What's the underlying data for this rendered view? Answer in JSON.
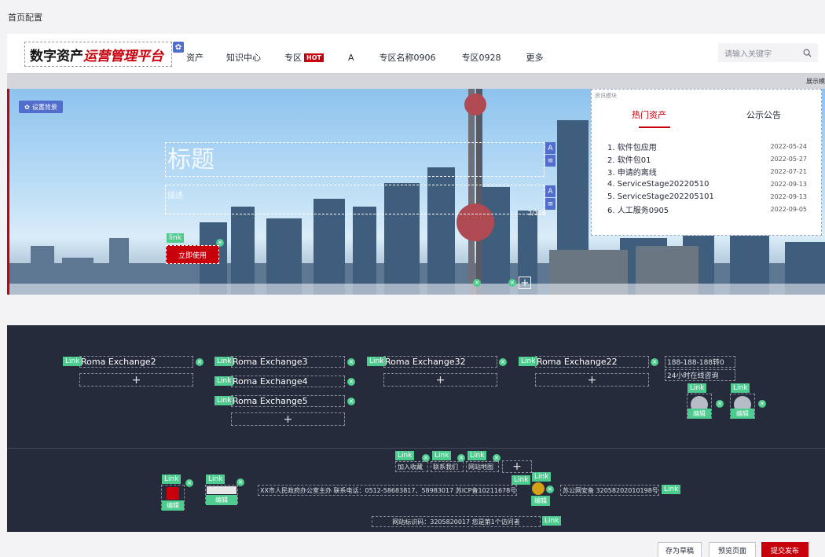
{
  "page_label": "首页配置",
  "header": {
    "logo_text_a": "数字资产",
    "logo_text_b": "运营管理平台",
    "nav": [
      "资产",
      "知识中心",
      "专区",
      "A",
      "专区名称0906",
      "专区0928",
      "更多"
    ],
    "hot_badge": "HOT",
    "search_placeholder": "请输入关键字"
  },
  "gray_bar_text": "展示模",
  "banner": {
    "set_bg_label": "设置背景",
    "title": "标题",
    "desc": "描述",
    "counter": "2/120",
    "link_tag": "link",
    "button_label": "立即使用",
    "add_symbol": "+"
  },
  "news": {
    "module_label": "资讯模块",
    "tabs": [
      "热门资产",
      "公示公告"
    ],
    "items": [
      {
        "title": "1. 软件包应用",
        "date": "2022-05-24"
      },
      {
        "title": "2. 软件包01",
        "date": "2022-05-27"
      },
      {
        "title": "3. 申请的离线",
        "date": "2022-07-21"
      },
      {
        "title": "4. ServiceStage20220510",
        "date": "2022-09-13"
      },
      {
        "title": "5. ServiceStage202205101",
        "date": "2022-09-13"
      },
      {
        "title": "6. 人工服务0905",
        "date": "2022-09-05"
      }
    ]
  },
  "footer": {
    "link_tag": "Link",
    "add_symbol": "+",
    "col1": [
      "Roma Exchange2"
    ],
    "col2": [
      "Roma Exchange3",
      "Roma Exchange4",
      "Roma Exchange5"
    ],
    "col3": [
      "Roma Exchange32"
    ],
    "col4": [
      "Roma Exchange22"
    ],
    "phone": "188-188-188转0",
    "service": "24小时在线咨询",
    "edit_label": "编辑",
    "bottom_links": [
      "加入收藏",
      "联系我们",
      "网站地图"
    ],
    "info_text": "XX市人民政府办公室主办 联系电话：0512-58683817、58983017 苏ICP备10211678号",
    "police_text": "苏公网安备 32058202010198号",
    "site_id_text": "网站标识码：3205820017 您是第1个访问者"
  },
  "actions": {
    "draft": "存为草稿",
    "preview": "预览页面",
    "publish": "提交发布"
  },
  "colors": {
    "brand_red": "#c7000b",
    "link_green": "#4ecb8f",
    "footer_bg": "#252b3a",
    "tool_blue": "#526ecc"
  }
}
